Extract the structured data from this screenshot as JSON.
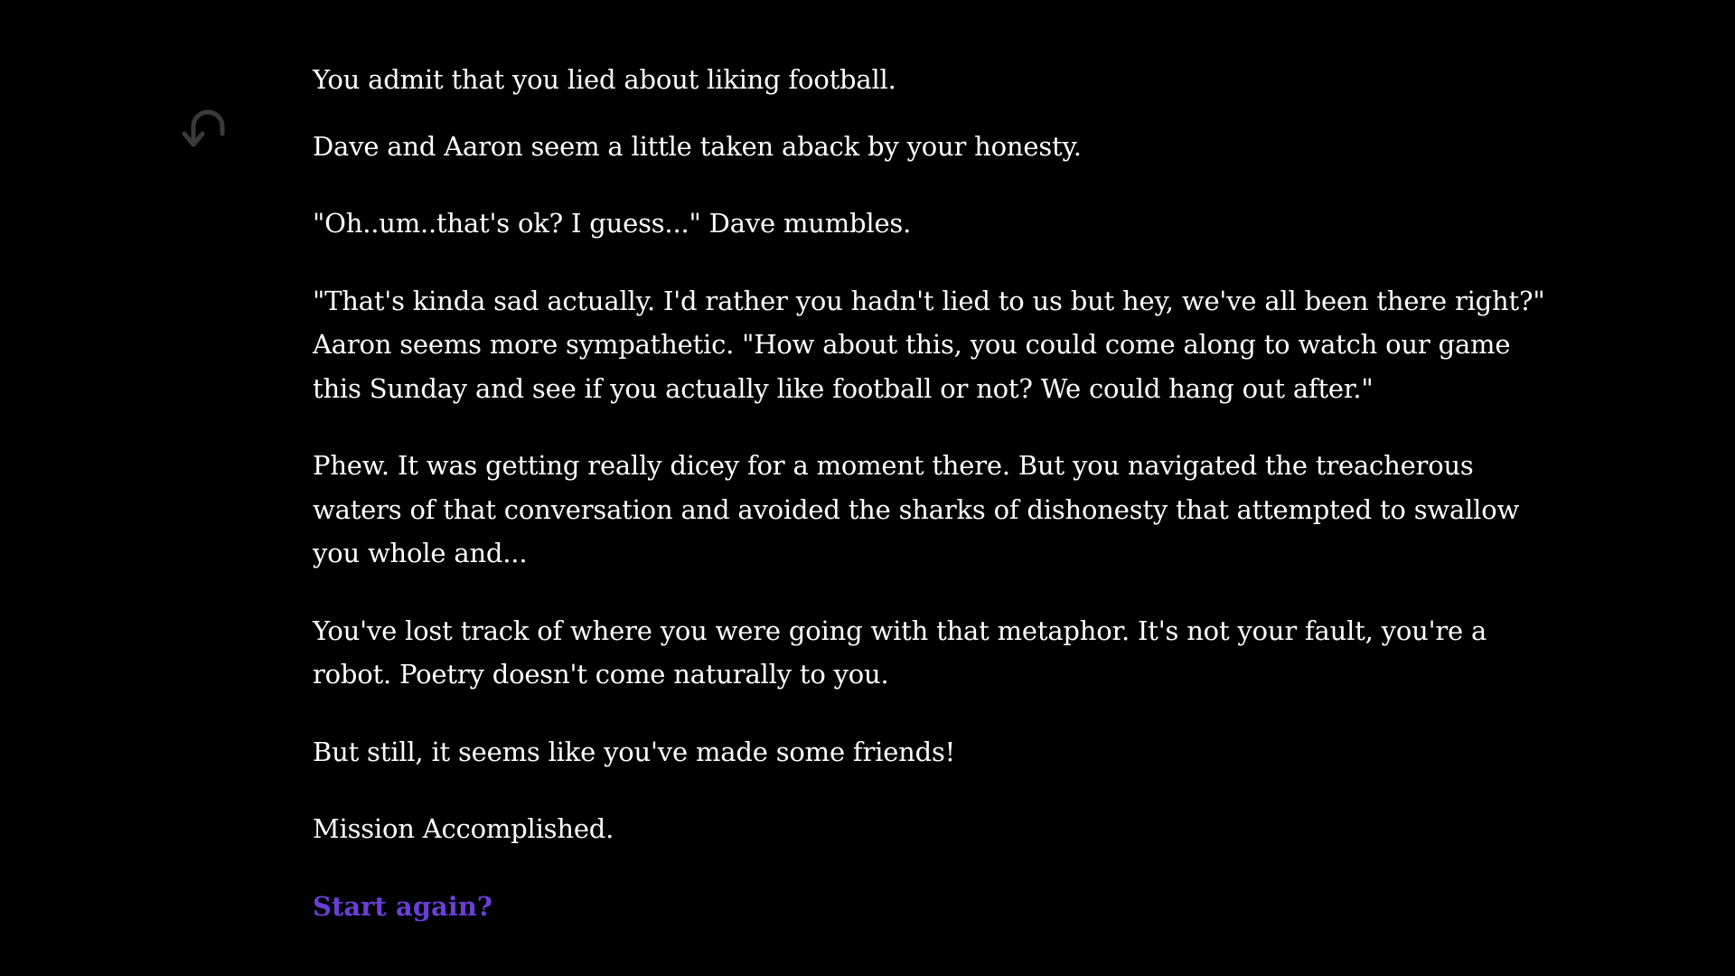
{
  "story": {
    "paragraphs": [
      "You admit that you lied about liking football.",
      "Dave and Aaron seem a little taken aback by your honesty.",
      "\"Oh..um..that's ok? I guess...\" Dave mumbles.",
      "\"That's kinda sad actually. I'd rather you hadn't lied to us but hey, we've all been there right?\" Aaron seems more sympathetic. \"How about this, you could come along to watch our game this Sunday and see if you actually like football or not? We could hang out after.\"",
      "Phew. It was getting really dicey for a moment there. But you navigated the treacherous waters of that conversation and avoided the sharks of dishonesty that attempted to swallow you whole and...",
      "You've lost track of where you were going with that metaphor. It's not your fault, you're a robot. Poetry doesn't come naturally to you.",
      "But still, it seems like you've made some friends!",
      "Mission Accomplished."
    ],
    "restart_label": "Start again?"
  },
  "controls": {
    "undo_icon": "undo-arrow-icon"
  },
  "colors": {
    "background": "#000000",
    "text": "#ffffff",
    "link": "#6a3fd6",
    "icon": "#3a3a3a"
  }
}
